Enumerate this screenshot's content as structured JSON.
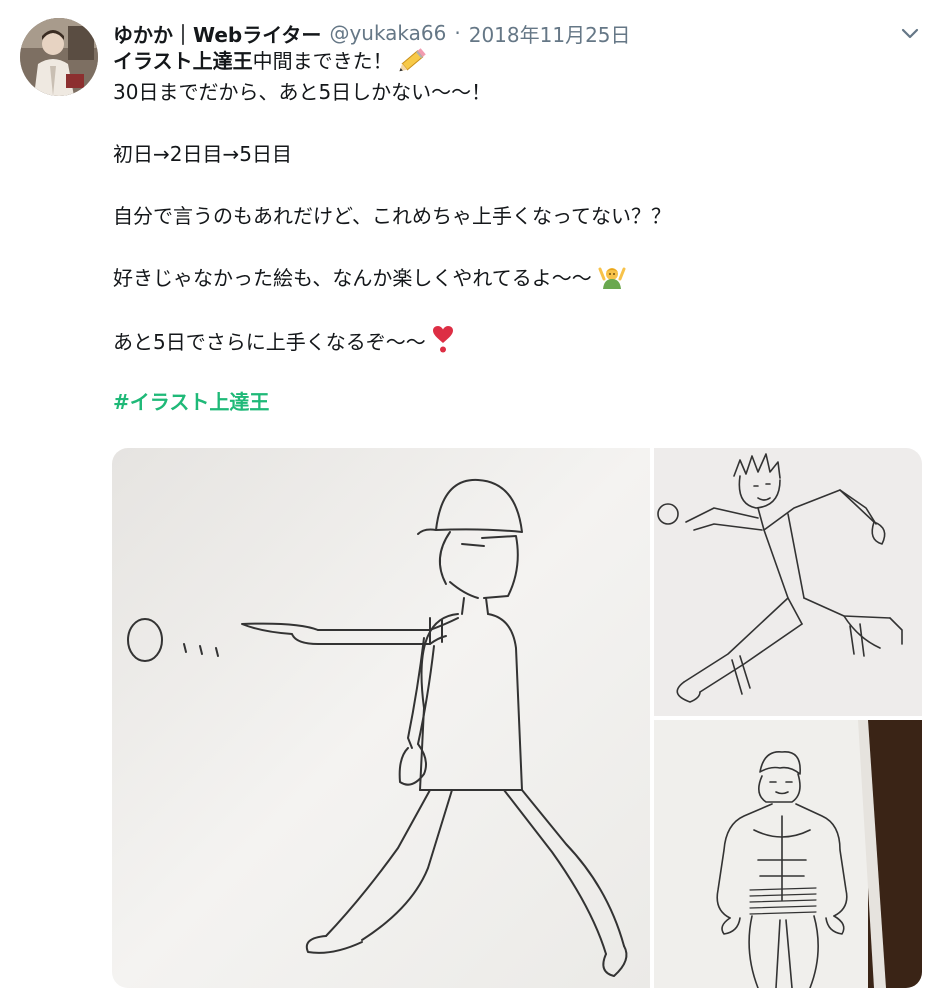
{
  "user": {
    "display_name": "ゆかか｜Webライター",
    "handle": "@yukaka66",
    "separator": "·",
    "date": "2018年11月25日",
    "avatar_icon": "user-avatar"
  },
  "tweet": {
    "line1_bold": "イラスト上達王",
    "line1_rest": "中間まできた！",
    "line1_emoji": "pencil-emoji",
    "line2": "30日までだから、あと5日しかない〜〜！",
    "line3": "初日→2日目→5日目",
    "line4": "自分で言うのもあれだけど、これめちゃ上手くなってない？？",
    "line5": "好きじゃなかった絵も、なんか楽しくやれてるよ〜〜",
    "line5_emoji": "person-raising-hands-emoji",
    "line6": "あと5日でさらに上手くなるぞ〜〜",
    "line6_emoji": "heart-exclamation-emoji",
    "hashtag": "#イラスト上達王"
  },
  "media": {
    "images": [
      {
        "name": "day1-drawing",
        "subject": "pencil sketch of person throwing a ball"
      },
      {
        "name": "day2-drawing",
        "subject": "pencil sketch of running figure"
      },
      {
        "name": "day5-drawing",
        "subject": "pencil sketch of muscular figure"
      }
    ]
  },
  "colors": {
    "text": "#14171a",
    "secondary": "#657786",
    "hashtag": "#1fb978",
    "paper": "#f3f2f0"
  },
  "icons": {
    "caret": "chevron-down-icon"
  }
}
